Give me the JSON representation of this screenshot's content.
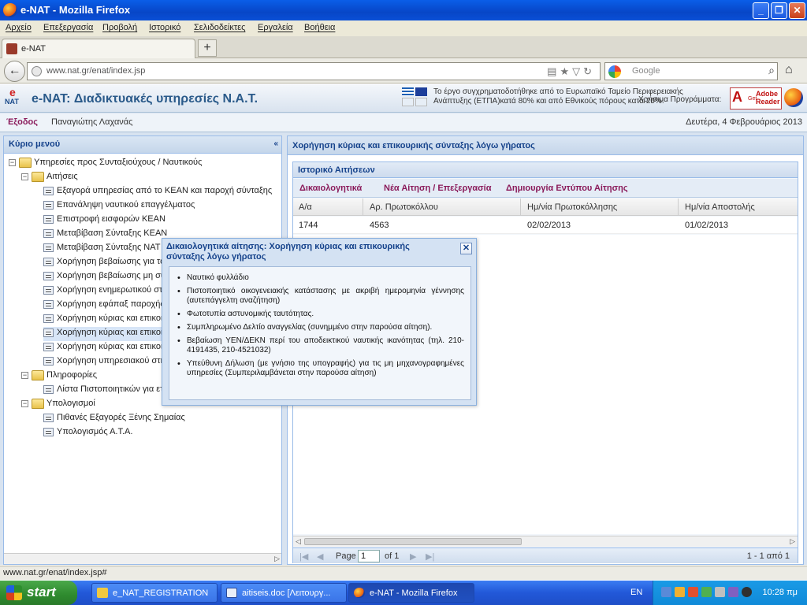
{
  "window": {
    "title": "e-NAT - Mozilla Firefox",
    "minimize": "_",
    "maximize": "❐",
    "close": "✕"
  },
  "menu": [
    "Αρχείο",
    "Επεξεργασία",
    "Προβολή",
    "Ιστορικό",
    "Σελιδοδείκτες",
    "Εργαλεία",
    "Βοήθεια"
  ],
  "tab": {
    "label": "e-NAT",
    "new_tab": "+"
  },
  "nav": {
    "back": "←",
    "url": "www.nat.gr/enat/index.jsp",
    "url_icons": "▤★▽↻",
    "search_placeholder": "Google",
    "search_icon": "⌕",
    "home": "⌂"
  },
  "app": {
    "logo_e": "e",
    "logo_nat": "NAT",
    "title": "e-NAT: Διαδικτυακές υπηρεσίες Ν.Α.Τ.",
    "eu_text": "Το έργο συγχρηματοδοτήθηκε από το Ευρωπαϊκό Ταμείο Περιφερειακής Ανάπτυξης (ΕΤΠΑ)κατά 80% και από Εθνικούς πόρους κατά 20%.",
    "program_text": "Χρήσιμα Προγράμματα:",
    "adobe_icon": "A",
    "adobe_get": "Get",
    "adobe_name": "Adobe Reader"
  },
  "userbar": {
    "logout": "Έξοδος",
    "user": "Παναγιώτης Λαχανάς",
    "date": "Δευτέρα, 4 Φεβρουάριος 2013"
  },
  "left_panel": {
    "title": "Κύριο μενού",
    "collapse": "«",
    "tree": {
      "root": "Υπηρεσίες προς Συνταξιούχους / Ναυτικούς",
      "requests": "Αιτήσεις",
      "items": [
        "Εξαγορά υπηρεσίας από το ΚΕΑΝ και παροχή σύνταξης",
        "Επανάληψη ναυτικού επαγγέλματος",
        "Επιστροφή εισφορών ΚΕΑΝ",
        "Μεταβίβαση Σύνταξης ΚΕΑΝ",
        "Μεταβίβαση Σύνταξης ΝΑΤ",
        "Χορήγηση βεβαίωσης για το",
        "Χορήγηση βεβαίωσης μη συ",
        "Χορήγηση ενημερωτικού στ",
        "Χορήγηση εφάπαξ παροχής",
        "Χορήγηση κύριας και επικοι",
        "Χορήγηση κύριας και επικοι",
        "Χορήγηση κύριας και επικοι",
        "Χορήγηση υπηρεσιακού στη"
      ],
      "info": "Πληροφορίες",
      "info_items": [
        "Λίστα Πιστοποιητικών για ετ"
      ],
      "calc": "Υπολογισμοί",
      "calc_items": [
        "Πιθανές Εξαγορές Ξένης Σημαίας",
        "Υπολογισμός Α.Τ.Α."
      ]
    },
    "toggle_minus": "−",
    "scroll_arrow": "▷"
  },
  "right_panel": {
    "title": "Χορήγηση κύριας και επικουρικής σύνταξης λόγω γήρατος",
    "history_title": "Ιστορικό Αιτήσεων",
    "toolbar": [
      "Δικαιολογητικά",
      "Νέα Αίτηση / Επεξεργασία",
      "Δημιουργία Εντύπου Αίτησης"
    ],
    "columns": [
      "Α/α",
      "Αρ. Πρωτοκόλλου",
      "Ημ/νία Πρωτοκόλλησης",
      "Ημ/νία Αποστολής"
    ],
    "rows": [
      [
        "1744",
        "4563",
        "02/02/2013",
        "01/02/2013"
      ]
    ],
    "scroll_left": "◁",
    "scroll_right": "▷",
    "pager": {
      "first": "|◀",
      "prev": "◀",
      "page_label": "Page",
      "page_value": "1",
      "of_label": "of 1",
      "next": "▶",
      "last": "▶|",
      "info": "1 - 1 από 1"
    }
  },
  "popup": {
    "title": "Δικαιολογητικά αίτησης: Χορήγηση κύριας και επικουρικής σύνταξης λόγω γήρατος",
    "close": "✕",
    "items": [
      "Ναυτικό φυλλάδιο",
      "Πιστοποιητικό οικογενειακής κατάστασης με ακριβή ημερομηνία γέννησης (αυτεπάγγελτη αναζήτηση)",
      "Φωτοτυπία αστυνομικής ταυτότητας.",
      "Συμπληρωμένο Δελτίο αναγγελίας (συνημμένο στην παρούσα αίτηση).",
      "Βεβαίωση ΥΕΝ/ΔΕΚΝ περί του αποδεικτικού ναυτικής ικανότητας (τηλ. 210-4191435, 210-4521032)",
      "Υπεύθυνη Δήλωση (με γνήσιο της υπογραφής) για τις μη μηχανογραφημένες υπηρεσίες (Συμπεριλαμβάνεται στην παρούσα αίτηση)"
    ]
  },
  "status_bar": "www.nat.gr/enat/index.jsp#",
  "taskbar": {
    "start": "start",
    "items": [
      "e_NAT_REGISTRATION",
      "aitiseis.doc [Λειτουργ...",
      "e-NAT - Mozilla Firefox"
    ],
    "lang": "EN",
    "clock": "10:28 πμ"
  }
}
